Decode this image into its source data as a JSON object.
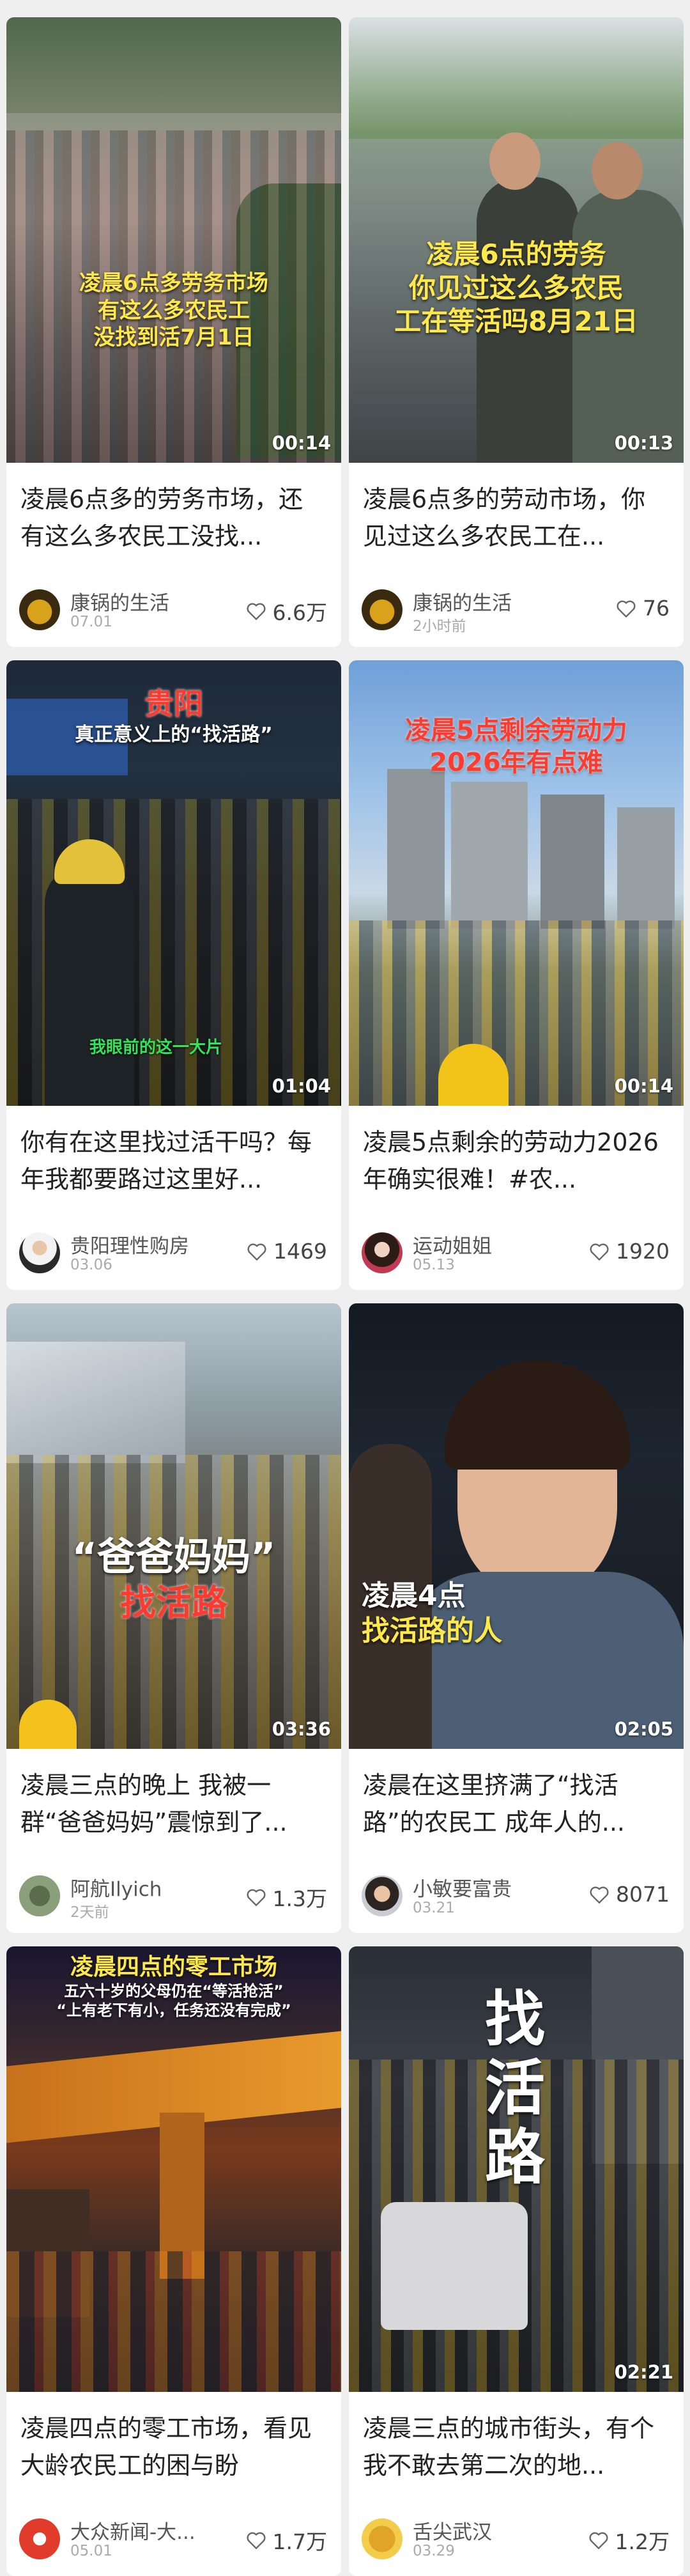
{
  "cards": [
    {
      "overlay": [
        "凌晨6点多劳务市场",
        "有这么多农民工",
        "没找到活7月1日"
      ],
      "duration": "00:14",
      "title": "凌晨6点多的劳务市场，还有这么多农民工没找...",
      "author": "康锅的生活",
      "date": "07.01",
      "likes": "6.6万"
    },
    {
      "overlay": [
        "凌晨6点的劳务",
        "你见过这么多农民",
        "工在等活吗8月21日"
      ],
      "duration": "00:13",
      "title": "凌晨6点多的劳动市场，你见过这么多农民工在...",
      "author": "康锅的生活",
      "date": "2小时前",
      "likes": "76"
    },
    {
      "overlay": [
        "贵阳",
        "真正意义上的“找活路”"
      ],
      "caption": "我眼前的这一大片",
      "duration": "01:04",
      "title": "你有在这里找过活干吗？每年我都要路过这里好...",
      "author": "贵阳理性购房",
      "date": "03.06",
      "likes": "1469"
    },
    {
      "overlay": [
        "凌晨5点剩余劳动力",
        "2026年有点难"
      ],
      "duration": "00:14",
      "title": "凌晨5点剩余的劳动力2026年确实很难！#农...",
      "author": "运动姐姐",
      "date": "05.13",
      "likes": "1920"
    },
    {
      "overlay": [
        "“爸爸妈妈”",
        "找活路"
      ],
      "duration": "03:36",
      "title": "凌晨三点的晚上 我被一群“爸爸妈妈”震惊到了...",
      "author": "阿航Ilyich",
      "date": "2天前",
      "likes": "1.3万"
    },
    {
      "overlay": [
        "凌晨4点",
        "找活路的人"
      ],
      "duration": "02:05",
      "title": "凌晨在这里挤满了“找活路”的农民工 成年人的...",
      "author": "小敏要富贵",
      "date": "03.21",
      "likes": "8071"
    },
    {
      "overlay": [
        "凌晨四点的零工市场",
        "五六十岁的父母仍在“等活抢活”",
        "“上有老下有小，任务还没有完成”"
      ],
      "duration": "",
      "title": "凌晨四点的零工市场，看见大龄农民工的困与盼",
      "author": "大众新闻-大...",
      "date": "05.01",
      "likes": "1.7万"
    },
    {
      "overlay": [
        "找",
        "活",
        "路"
      ],
      "duration": "02:21",
      "title": "凌晨三点的城市街头，有个我不敢去第二次的地...",
      "author": "舌尖武汉",
      "date": "03.29",
      "likes": "1.2万"
    }
  ],
  "colors": {
    "title": "#222222",
    "author": "#555555",
    "date": "#aaaaaa",
    "overlay_yellow": "#ffe94a",
    "overlay_red": "#ff3b2f"
  },
  "icons": {
    "like": "heart-outline-icon"
  }
}
